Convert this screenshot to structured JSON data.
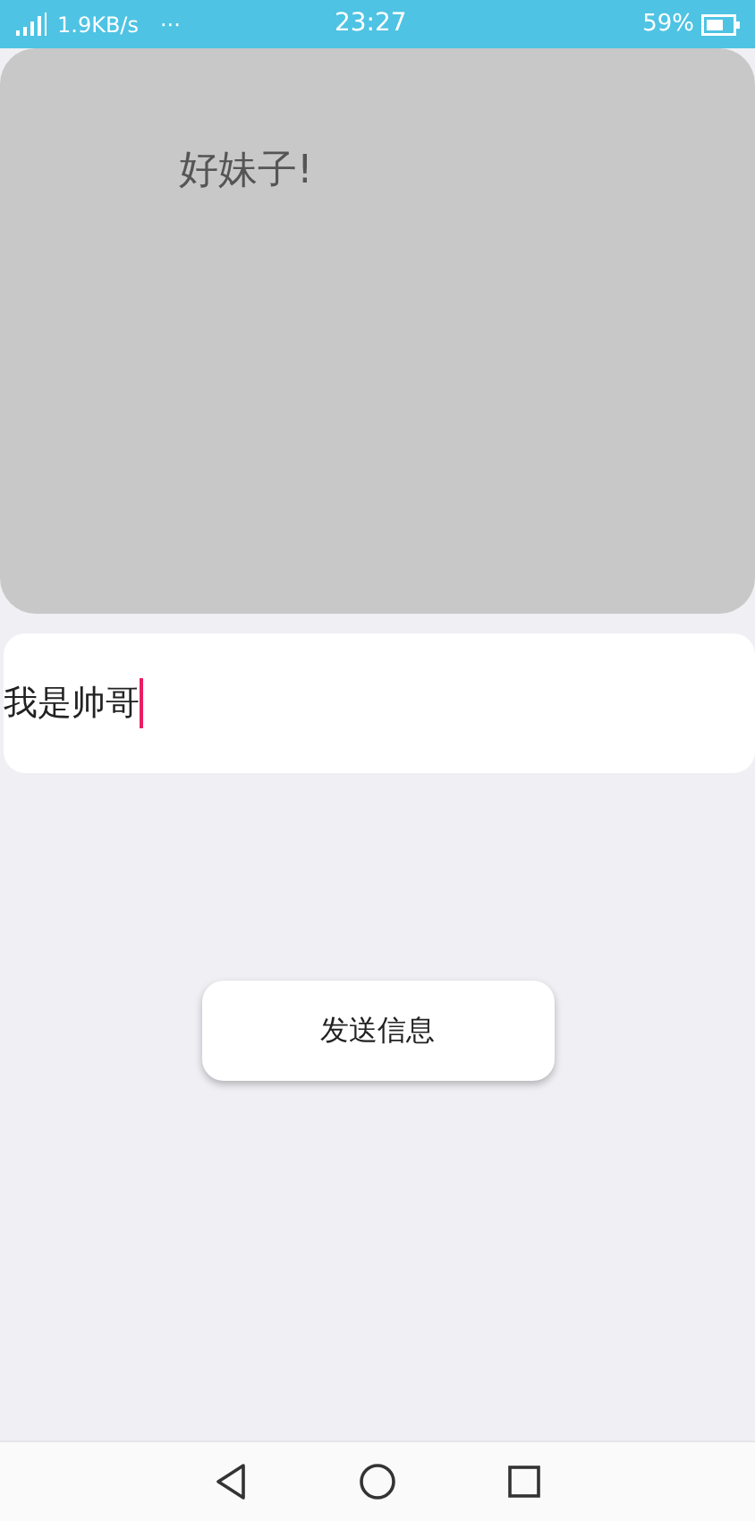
{
  "status_bar": {
    "speed": "1.9KB/s",
    "more": "···",
    "time": "23:27",
    "battery": "59%"
  },
  "message_panel": {
    "text": "好妹子!"
  },
  "input": {
    "value": "我是帅哥",
    "focused": true
  },
  "send_button": {
    "label": "发送信息"
  }
}
